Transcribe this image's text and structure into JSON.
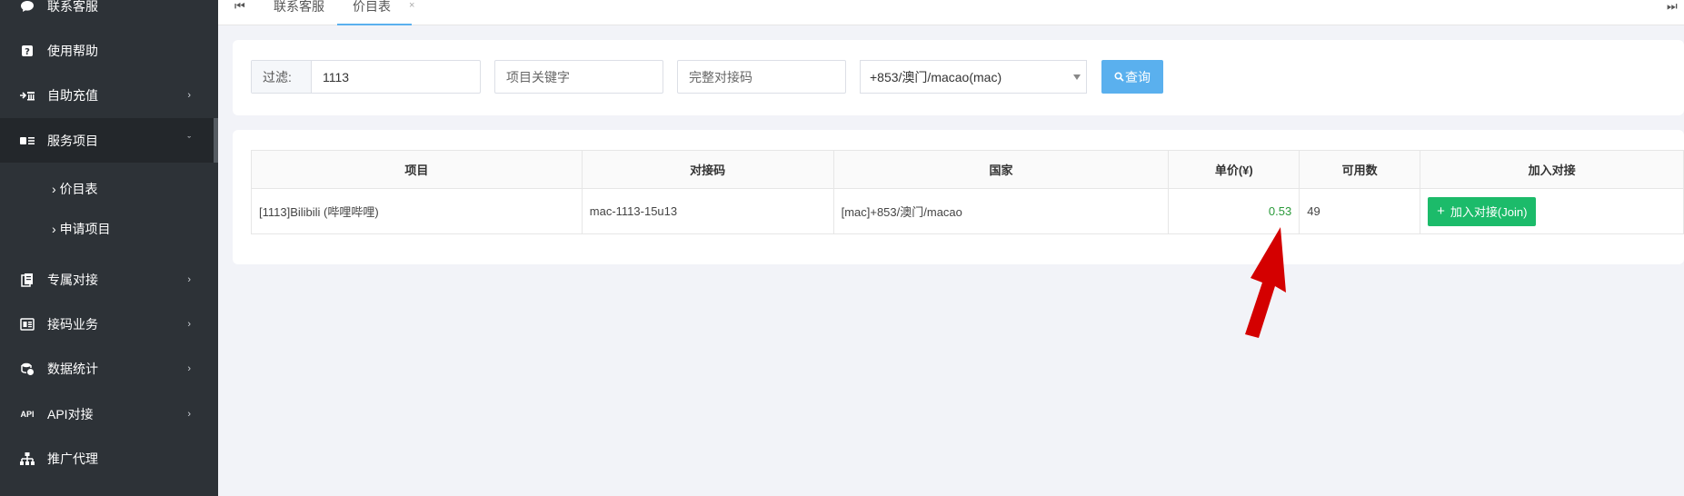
{
  "sidebar": {
    "items": [
      {
        "label": "联系客服",
        "icon": "chat-bubble-icon",
        "has_children": false
      },
      {
        "label": "使用帮助",
        "icon": "help-icon",
        "has_children": false
      },
      {
        "label": "自助充值",
        "icon": "recharge-icon",
        "has_children": true
      },
      {
        "label": "服务项目",
        "icon": "service-list-icon",
        "has_children": true
      },
      {
        "label": "专属对接",
        "icon": "exclusive-docs-icon",
        "has_children": true
      },
      {
        "label": "接码业务",
        "icon": "code-business-icon",
        "has_children": true
      },
      {
        "label": "数据统计",
        "icon": "data-stats-icon",
        "has_children": true
      },
      {
        "label": "API对接",
        "icon": "api-icon",
        "has_children": true
      },
      {
        "label": "推广代理",
        "icon": "org-tree-icon",
        "has_children": false
      }
    ],
    "submenu": [
      {
        "label": "价目表"
      },
      {
        "label": "申请项目"
      }
    ],
    "api_icon_text": "API"
  },
  "tabs": {
    "items": [
      {
        "label": "联系客服"
      },
      {
        "label": "价目表"
      }
    ]
  },
  "filter": {
    "label": "过滤:",
    "value": "1113",
    "keyword_placeholder": "项目关键字",
    "code_placeholder": "完整对接码",
    "country_selected": "+853/澳门/macao(mac)",
    "query_label": "查询"
  },
  "table": {
    "columns": [
      "项目",
      "对接码",
      "国家",
      "单价(¥)",
      "可用数",
      "加入对接"
    ],
    "rows": [
      {
        "project": "[1113]Bilibili (哔哩哔哩)",
        "code": "mac-1113-15u13",
        "country": "[mac]+853/澳门/macao",
        "price": "0.53",
        "available": "49",
        "action": "加入对接(Join)"
      }
    ]
  },
  "colors": {
    "sidebar_bg": "#2d3237",
    "accent": "#5ab0ee",
    "join_green": "#1cbb6a",
    "price_green": "#2a9a3a",
    "annotation_red": "#d40000"
  }
}
